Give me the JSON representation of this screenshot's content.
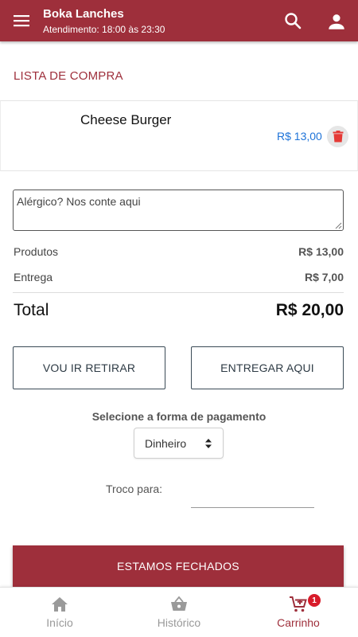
{
  "header": {
    "title": "Boka Lanches",
    "subtitle": "Atendimento: 18:00 às 23:30",
    "icons": [
      "menu-icon",
      "search-icon",
      "account-icon"
    ]
  },
  "cart": {
    "section_title": "LISTA DE COMPRA",
    "items": [
      {
        "name": "Cheese Burger",
        "price": "R$ 13,00",
        "action_icon": "trash-icon"
      }
    ]
  },
  "note": {
    "placeholder": "Alérgico? Nos conte aqui",
    "value": ""
  },
  "summary": {
    "products_label": "Produtos",
    "products_value": "R$ 13,00",
    "delivery_label": "Entrega",
    "delivery_value": "R$ 7,00",
    "total_label": "Total",
    "total_value": "R$ 20,00"
  },
  "delivery_options": {
    "pickup_label": "VOU IR RETIRAR",
    "deliver_label": "ENTREGAR AQUI"
  },
  "payment": {
    "label": "Selecione a forma de pagamento",
    "selected": "Dinheiro",
    "change_label": "Troco para:",
    "change_value": ""
  },
  "status_button_label": "ESTAMOS FECHADOS",
  "bottom_nav": {
    "items": [
      {
        "label": "Início",
        "icon": "home-icon",
        "active": false
      },
      {
        "label": "Histórico",
        "icon": "basket-icon",
        "active": false
      },
      {
        "label": "Carrinho",
        "icon": "cart-icon",
        "active": true,
        "badge": "1"
      }
    ]
  },
  "colors": {
    "primary": "#9e2f3b",
    "price_link": "#1e73d8",
    "delete_icon": "#e53935",
    "badge": "#d81b2a"
  }
}
